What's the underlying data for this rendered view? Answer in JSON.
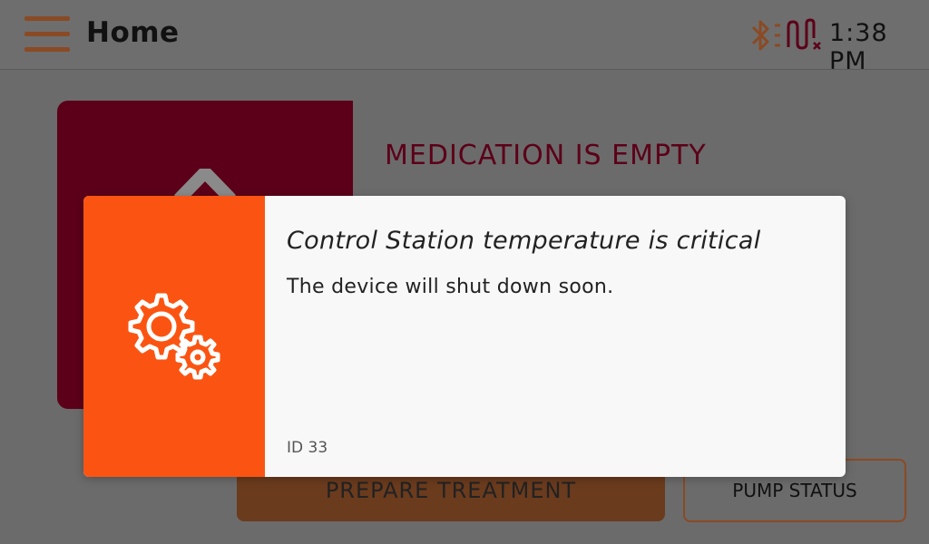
{
  "header": {
    "title": "Home",
    "time": "1:38 PM",
    "menu_icon": "hamburger-menu-icon",
    "status_icons": [
      "bluetooth-icon",
      "signal-disconnected-icon"
    ]
  },
  "background": {
    "alarm_heading": "MEDICATION IS EMPTY",
    "prepare_label": "PREPARE TREATMENT",
    "pump_status_label": "PUMP STATUS"
  },
  "modal": {
    "title": "Control Station temperature is critical",
    "message": "The device will shut down soon.",
    "id_label": "ID 33",
    "icon": "gears-icon"
  },
  "colors": {
    "accent_brown": "#8a4a24",
    "alarm_red": "#5c0019",
    "warning_orange": "#fb5412",
    "overlay_gray": "#6b6b6b",
    "modal_bg": "#f8f8f8"
  }
}
